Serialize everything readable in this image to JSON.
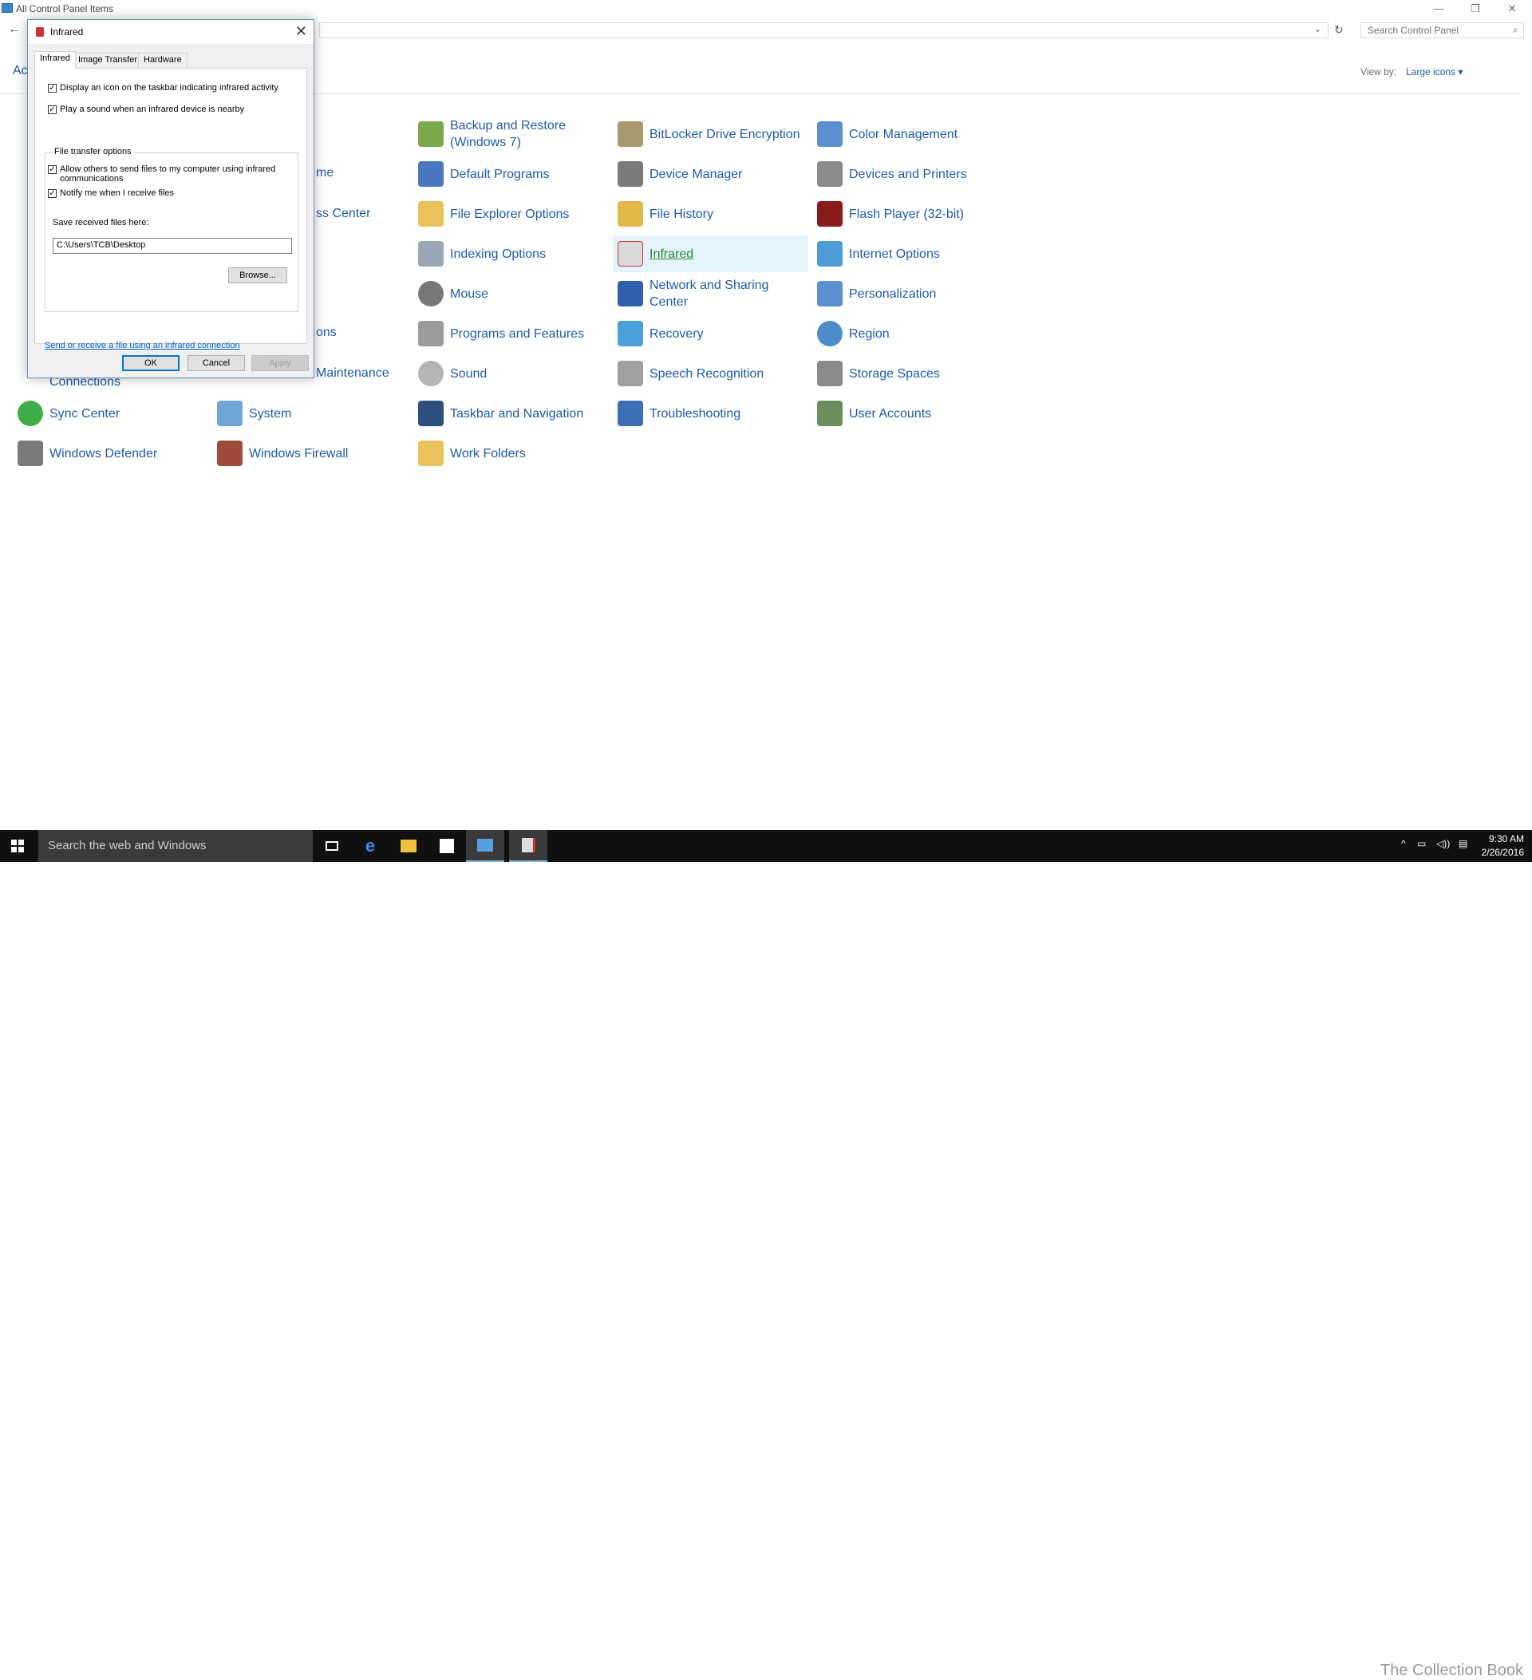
{
  "window": {
    "title": "All Control Panel Items",
    "minimize": "—",
    "restore": "❐",
    "close": "✕"
  },
  "search": {
    "placeholder": "Search Control Panel"
  },
  "view_by": {
    "label": "View by:",
    "value": "Large icons ▾"
  },
  "adjust_truncated": "Ac",
  "items": [
    {
      "label": "Backup and Restore (Windows 7)",
      "icon": "backup-icon"
    },
    {
      "label": "BitLocker Drive Encryption",
      "icon": "bitlocker-icon"
    },
    {
      "label": "Color Management",
      "icon": "color-management-icon"
    },
    {
      "label": "Default Programs",
      "icon": "default-programs-icon"
    },
    {
      "label": "Device Manager",
      "icon": "device-manager-icon"
    },
    {
      "label": "Devices and Printers",
      "icon": "printer-icon"
    },
    {
      "label": "File Explorer Options",
      "icon": "folder-options-icon"
    },
    {
      "label": "File History",
      "icon": "file-history-icon"
    },
    {
      "label": "Flash Player (32-bit)",
      "icon": "flash-icon"
    },
    {
      "label": "Indexing Options",
      "icon": "indexing-icon"
    },
    {
      "label": "Infrared",
      "icon": "infrared-icon"
    },
    {
      "label": "Internet Options",
      "icon": "internet-options-icon"
    },
    {
      "label": "Mouse",
      "icon": "mouse-icon"
    },
    {
      "label": "Network and Sharing Center",
      "icon": "network-icon"
    },
    {
      "label": "Personalization",
      "icon": "personalization-icon"
    },
    {
      "label": "Programs and Features",
      "icon": "programs-icon"
    },
    {
      "label": "Recovery",
      "icon": "recovery-icon"
    },
    {
      "label": "Region",
      "icon": "region-icon"
    },
    {
      "label": "Sound",
      "icon": "sound-icon"
    },
    {
      "label": "Speech Recognition",
      "icon": "microphone-icon"
    },
    {
      "label": "Storage Spaces",
      "icon": "storage-icon"
    },
    {
      "label": "Taskbar and Navigation",
      "icon": "taskbar-icon"
    },
    {
      "label": "Troubleshooting",
      "icon": "troubleshooting-icon"
    },
    {
      "label": "User Accounts",
      "icon": "users-icon"
    },
    {
      "label": "Work Folders",
      "icon": "work-folders-icon"
    },
    {
      "label": "Sync Center",
      "icon": "sync-icon"
    },
    {
      "label": "System",
      "icon": "system-icon"
    },
    {
      "label": "Windows Defender",
      "icon": "defender-icon"
    },
    {
      "label": "Windows Firewall",
      "icon": "firewall-icon"
    }
  ],
  "partial_labels": [
    "me",
    "ss Center",
    "ons",
    "Maintenance",
    "Connections"
  ],
  "dialog": {
    "title": "Infrared",
    "tabs": [
      "Infrared",
      "Image Transfer",
      "Hardware"
    ],
    "check_display_icon": "Display an icon on the taskbar indicating infrared activity",
    "check_play_sound": "Play a sound when an infrared device is nearby",
    "group_label": "File transfer options",
    "check_allow_others": "Allow others to send files to my computer using infrared communications",
    "check_notify": "Notify me when I receive files",
    "save_label": "Save received files here:",
    "save_path": "C:\\Users\\TCB\\Desktop",
    "browse": "Browse...",
    "link": "Send or receive a file using an infrared connection",
    "ok": "OK",
    "cancel": "Cancel",
    "apply": "Apply"
  },
  "taskbar": {
    "search_placeholder": "Search the web and Windows",
    "time": "9:30 AM",
    "date": "2/26/2016",
    "watermark": "The Collection Book"
  }
}
